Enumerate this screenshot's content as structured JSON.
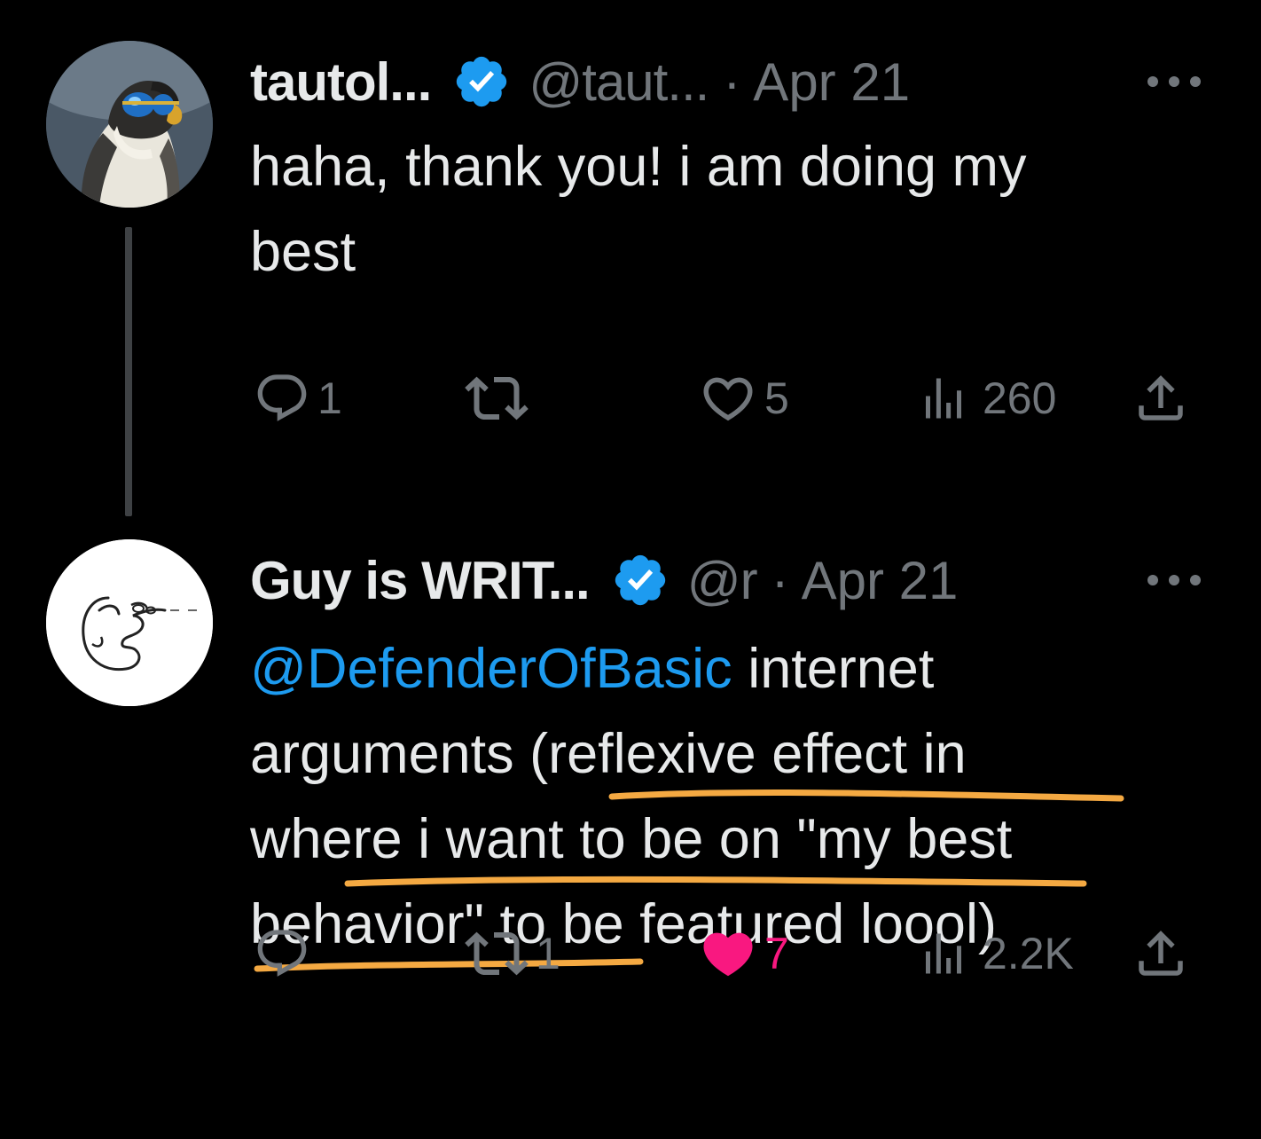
{
  "tweets": [
    {
      "display_name": "tautol...",
      "handle": "@taut...",
      "date": "Apr 21",
      "body_lines": [
        "haha, thank you! i am doing my",
        "best"
      ],
      "actions": {
        "reply_count": "1",
        "repost_count": "",
        "like_count": "5",
        "views_count": "260"
      },
      "liked": false
    },
    {
      "display_name": "Guy is WRIT...",
      "handle": "@r",
      "date": "Apr 21",
      "mention": "@DefenderOfBasic",
      "body_lines": [
        " internet",
        "arguments (reflexive effect in",
        "where i want to be on \"my best",
        "behavior\" to be featured loool)"
      ],
      "actions": {
        "reply_count": "",
        "repost_count": "1",
        "like_count": "7",
        "views_count": "2.2K"
      },
      "liked": true
    }
  ],
  "separator": "·",
  "icons": {
    "verified": "verified-badge-icon",
    "more": "more-dots-icon",
    "reply": "reply-icon",
    "repost": "repost-icon",
    "like": "heart-icon",
    "views": "views-icon",
    "share": "share-icon"
  },
  "colors": {
    "background": "#000000",
    "text": "#e7e9ea",
    "muted": "#71767b",
    "accent": "#1d9bf0",
    "like": "#f91880",
    "highlight_underline": "#f4a942"
  }
}
